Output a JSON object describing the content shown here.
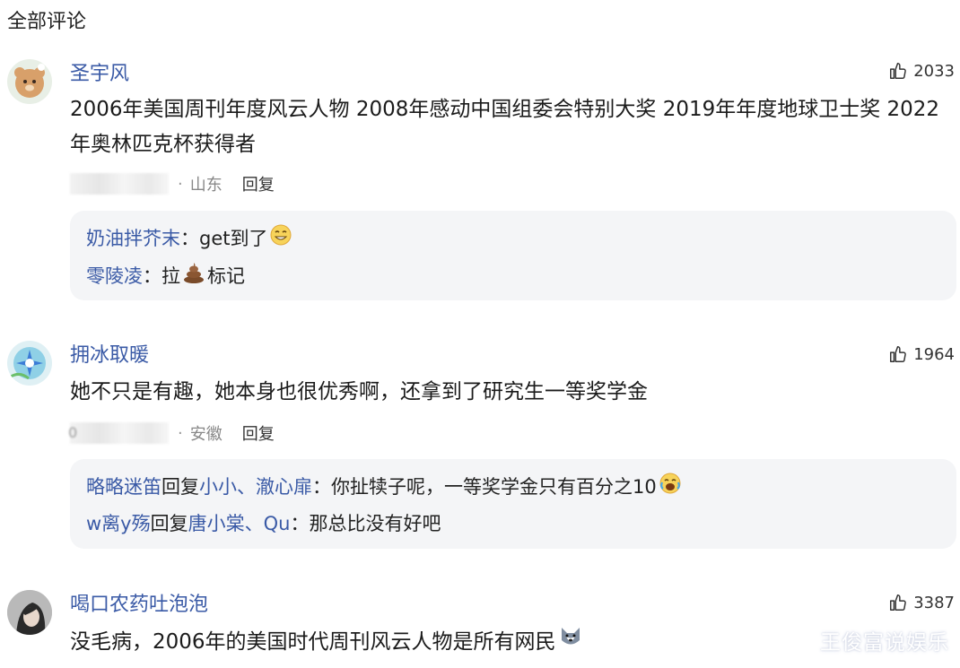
{
  "header": {
    "title": "全部评论"
  },
  "comments": [
    {
      "username": "圣宇风",
      "likes": "2033",
      "text": "2006年美国周刊年度风云人物 2008年感动中国组委会特别大奖 2019年年度地球卫士奖 2022年奥林匹克杯获得者",
      "location": "山东",
      "reply_label": "回复",
      "replies": [
        {
          "name": "奶油拌芥末",
          "sep": "：",
          "text": "get到了",
          "emoji": "smile-emoji"
        },
        {
          "name": "零陵凌",
          "sep": "：",
          "text_before": "拉",
          "emoji": "poop-emoji",
          "text_after": "标记"
        }
      ]
    },
    {
      "username": "拥冰取暖",
      "likes": "1964",
      "text": "她不只是有趣，她本身也很优秀啊，还拿到了研究生一等奖学金",
      "meta_prefix": "0",
      "location": "安徽",
      "reply_label": "回复",
      "replies": [
        {
          "name": "略略迷笛",
          "mid": "回复",
          "target": "小小、澈心扉",
          "sep": "：",
          "text": "你扯犊子呢，一等奖学金只有百分之10",
          "emoji": "cry-laugh-emoji"
        },
        {
          "name": "w离y殇",
          "mid": "回复",
          "target": "唐小棠、Qu",
          "sep": "：",
          "text": "那总比没有好吧"
        }
      ]
    },
    {
      "username": "喝口农药吐泡泡",
      "likes": "3387",
      "text": "没毛病，2006年的美国时代周刊风云人物是所有网民",
      "emoji": "husky-emoji"
    }
  ],
  "watermark": "王俊富说娱乐"
}
